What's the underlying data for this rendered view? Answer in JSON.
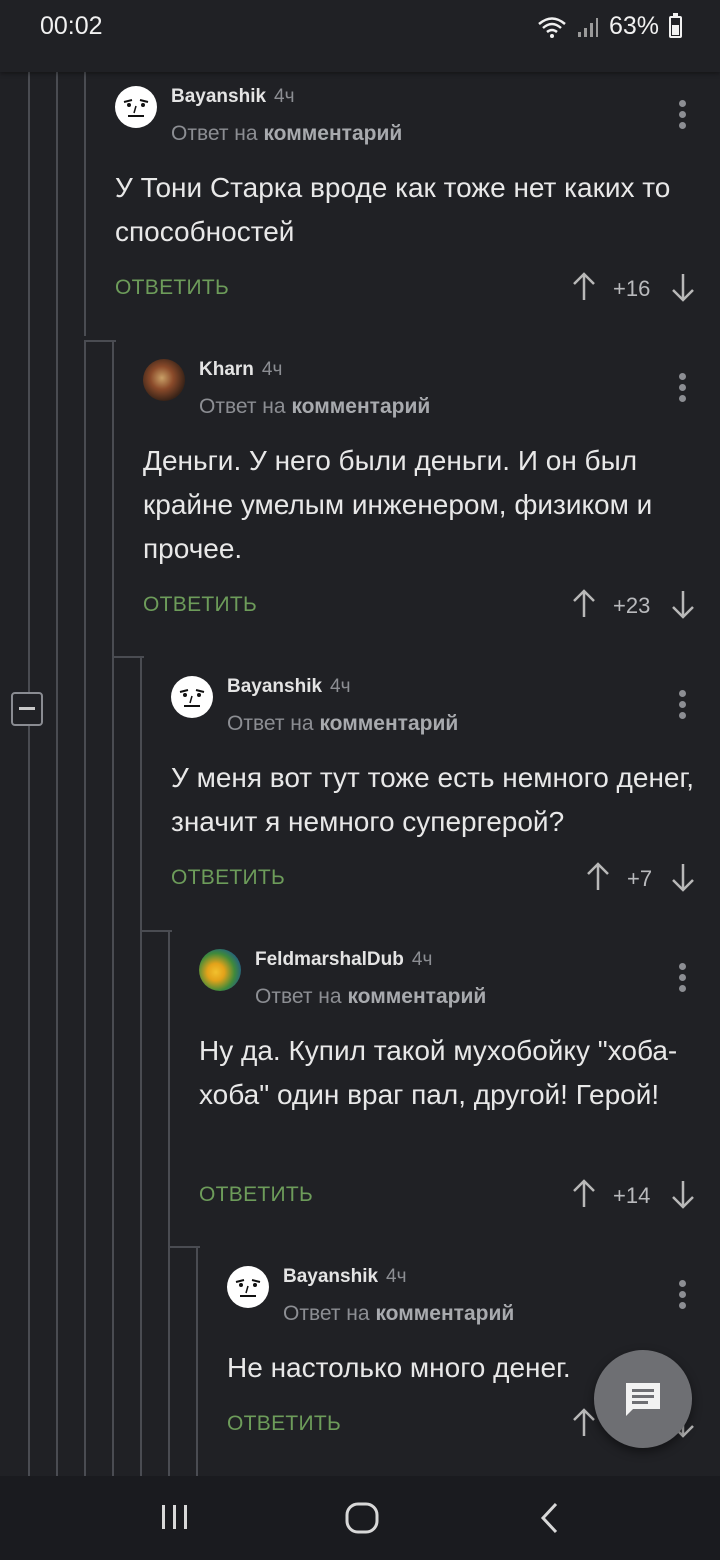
{
  "status_bar": {
    "time": "00:02",
    "battery": "63%"
  },
  "labels": {
    "reply_prefix": "Ответ на",
    "reply_target": "комментарий",
    "answer": "ОТВЕТИТЬ"
  },
  "comments": [
    {
      "author": "Bayanshik",
      "time": "4ч",
      "text": "У Тони Старка вроде как тоже нет каких то способностей",
      "rating": "+16"
    },
    {
      "author": "Kharn",
      "time": "4ч",
      "text": "Деньги. У него были деньги. И он был крайне умелым инженером, физиком и прочее.",
      "rating": "+23"
    },
    {
      "author": "Bayanshik",
      "time": "4ч",
      "text": "У меня вот тут тоже есть немного денег, значит я немного супергерой?",
      "rating": "+7"
    },
    {
      "author": "FeldmarshalDub",
      "time": "4ч",
      "text": "Ну да. Купил такой мухобойку \"хоба-хоба\" один враг пал, другой! Герой!",
      "rating": "+14"
    },
    {
      "author": "Bayanshik",
      "time": "4ч",
      "text": "Не настолько много денег.",
      "rating": ""
    }
  ],
  "icons": {
    "more": "more-vertical-icon",
    "upvote": "arrow-up-icon",
    "downvote": "arrow-down-icon",
    "fab": "comment-icon",
    "collapse": "minus-box-icon"
  },
  "colors": {
    "background": "#202125",
    "answer_link": "#6d9c5a",
    "thread_line": "#4a4c52"
  }
}
